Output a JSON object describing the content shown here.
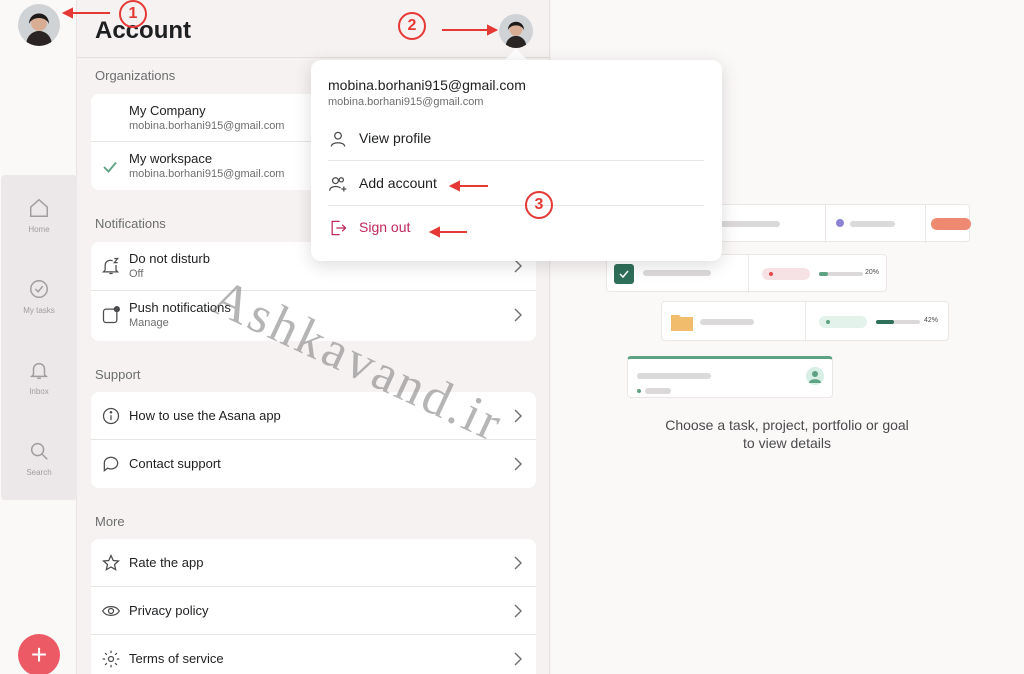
{
  "rail": {
    "nav": [
      {
        "label": "Home",
        "icon": "home-icon"
      },
      {
        "label": "My tasks",
        "icon": "check-circle-icon"
      },
      {
        "label": "Inbox",
        "icon": "bell-icon"
      },
      {
        "label": "Search",
        "icon": "search-icon"
      }
    ],
    "fab_label": "+"
  },
  "account": {
    "title": "Account",
    "organizations_title": "Organizations",
    "organizations": [
      {
        "name": "My Company",
        "email": "mobina.borhani915@gmail.com"
      },
      {
        "name": "My workspace",
        "email": "mobina.borhani915@gmail.com"
      }
    ],
    "notifications_title": "Notifications",
    "notifications": [
      {
        "title": "Do not disturb",
        "sub": "Off"
      },
      {
        "title": "Push notifications",
        "sub": "Manage"
      }
    ],
    "support_title": "Support",
    "support": [
      {
        "label": "How to use the Asana app"
      },
      {
        "label": "Contact support"
      }
    ],
    "more_title": "More",
    "more": [
      {
        "label": "Rate the app"
      },
      {
        "label": "Privacy policy"
      },
      {
        "label": "Terms of service"
      }
    ]
  },
  "menu": {
    "email": "mobina.borhani915@gmail.com",
    "email_sub": "mobina.borhani915@gmail.com",
    "view_profile": "View profile",
    "add_account": "Add account",
    "sign_out": "Sign out"
  },
  "detail": {
    "progress_1": "20%",
    "progress_2": "42%",
    "empty_message": "Choose a task, project, portfolio or goal to view details"
  },
  "annotations": {
    "n1": "1",
    "n2": "2",
    "n3": "3",
    "watermark": "Ashkavand.ir"
  },
  "colors": {
    "accent_red": "#ec5a66",
    "signout": "#c0275b",
    "check_green": "#5da283",
    "annotation_red": "#e53935"
  }
}
